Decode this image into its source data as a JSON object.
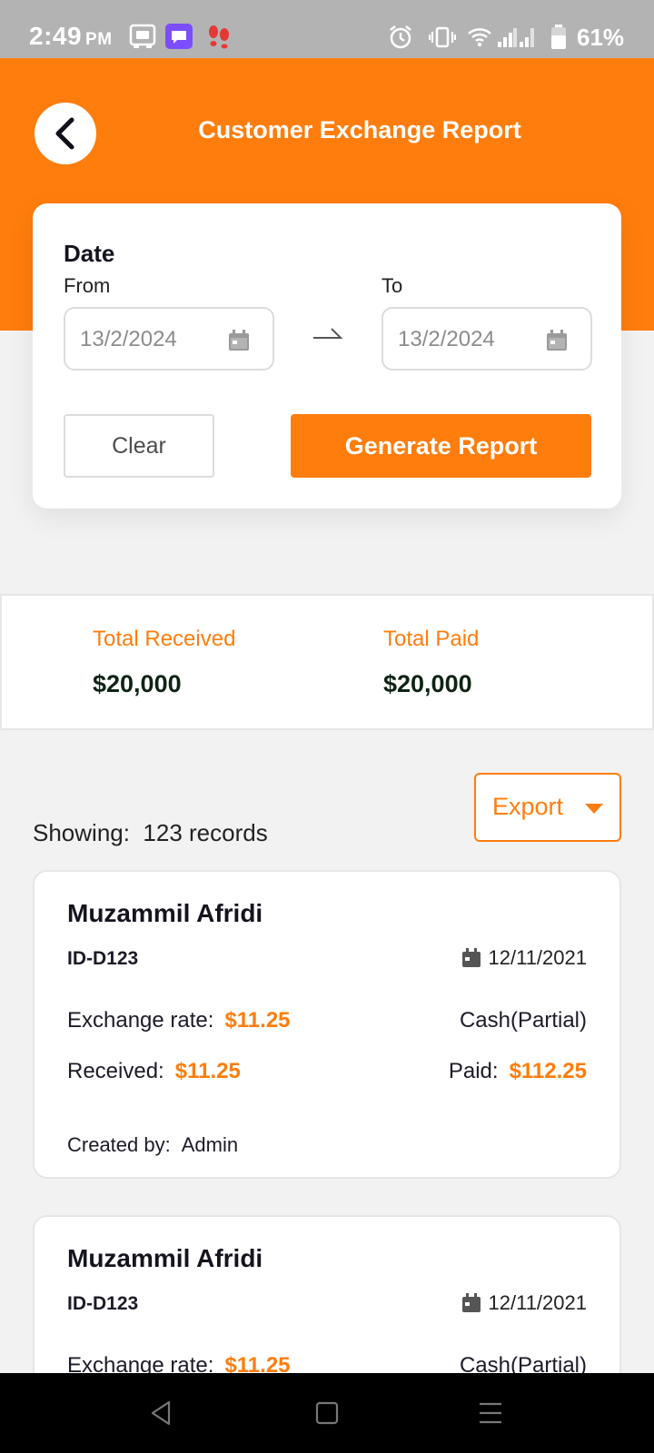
{
  "status_bar": {
    "time": "2:49",
    "ampm": "PM",
    "battery": "61%",
    "icons": [
      "screenshot-app-icon",
      "chat-app-icon",
      "footsteps-app-icon",
      "alarm-icon",
      "vibrate-icon",
      "wifi-icon",
      "signal-icon",
      "battery-icon"
    ]
  },
  "header": {
    "title": "Customer Exchange Report",
    "back_icon": "chevron-left-icon"
  },
  "filter": {
    "date_label": "Date",
    "from_label": "From",
    "to_label": "To",
    "from_value": "13/2/2024",
    "to_value": "13/2/2024",
    "clear_label": "Clear",
    "generate_label": "Generate Report"
  },
  "totals": {
    "received_label": "Total Received",
    "received_value": "$20,000",
    "paid_label": "Total Paid",
    "paid_value": "$20,000"
  },
  "records_bar": {
    "showing_label": "Showing:",
    "showing_value": "123 records",
    "export_label": "Export"
  },
  "records": [
    {
      "name": "Muzammil Afridi",
      "id": "ID-D123",
      "date": "12/11/2021",
      "exchange_rate_label": "Exchange rate:",
      "exchange_rate": "$11.25",
      "method": "Cash(Partial)",
      "received_label": "Received:",
      "received": "$11.25",
      "paid_label": "Paid:",
      "paid": "$112.25",
      "created_by_label": "Created by:",
      "created_by": "Admin"
    },
    {
      "name": "Muzammil Afridi",
      "id": "ID-D123",
      "date": "12/11/2021",
      "exchange_rate_label": "Exchange rate:",
      "exchange_rate": "$11.25",
      "method": "Cash(Partial)"
    }
  ],
  "colors": {
    "accent": "#ff7d0d",
    "status_bar": "#b3b3b3",
    "background": "#f2f2f2",
    "value_dark": "#0f2414"
  }
}
